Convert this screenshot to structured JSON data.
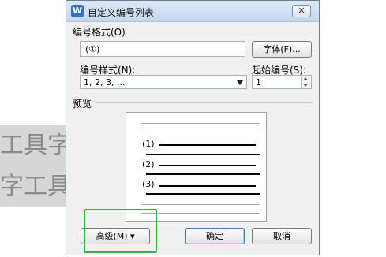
{
  "background": {
    "line1": "工具字",
    "line2": "字工具"
  },
  "dialog": {
    "title": "自定义编号列表",
    "app_icon": "W",
    "close_glyph": "✕",
    "number_format_label": "编号格式(O)",
    "number_format_value": "(①)",
    "font_button": "字体(F)...",
    "number_style_label": "编号样式(N):",
    "number_style_value": "1, 2, 3, ...",
    "start_number_label": "起始编号(S):",
    "start_number_value": "1",
    "preview_label": "预览",
    "preview_items": [
      "(1)",
      "(2)",
      "(3)"
    ],
    "advanced_button": "高级(M) ▾",
    "ok_button": "确定",
    "cancel_button": "取消"
  },
  "colors": {
    "highlight": "#35b23d",
    "titlebar": "#c6d8ef",
    "dialog_bg": "#f0f0f0"
  }
}
